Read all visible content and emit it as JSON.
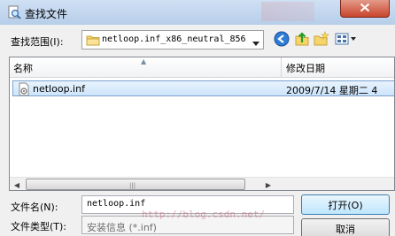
{
  "window": {
    "title": "查找文件",
    "title_bar_color": "#b9d1ea",
    "close_icon": "close-icon"
  },
  "look_in": {
    "label": "查找范围(I):",
    "value": "netloop.inf_x86_neutral_856",
    "icon": "folder-icon"
  },
  "toolbar": {
    "back_icon": "back-arrow-icon",
    "up_icon": "up-folder-icon",
    "new_folder_icon": "new-folder-icon",
    "views_icon": "view-menu-icon"
  },
  "file_list": {
    "columns": {
      "name": "名称",
      "date": "修改日期"
    },
    "rows": [
      {
        "name": "netloop.inf",
        "date": "2009/7/14 星期二 4",
        "icon": "inf-file-icon"
      }
    ],
    "selection_color": "#cde4fb"
  },
  "file_name": {
    "label": "文件名(N):",
    "value": "netloop.inf"
  },
  "file_type": {
    "label": "文件类型(T):",
    "value": "安装信息 (*.inf)"
  },
  "buttons": {
    "open": "打开(O)",
    "cancel": "取消"
  },
  "watermark": "http://blog.csdn.net/"
}
